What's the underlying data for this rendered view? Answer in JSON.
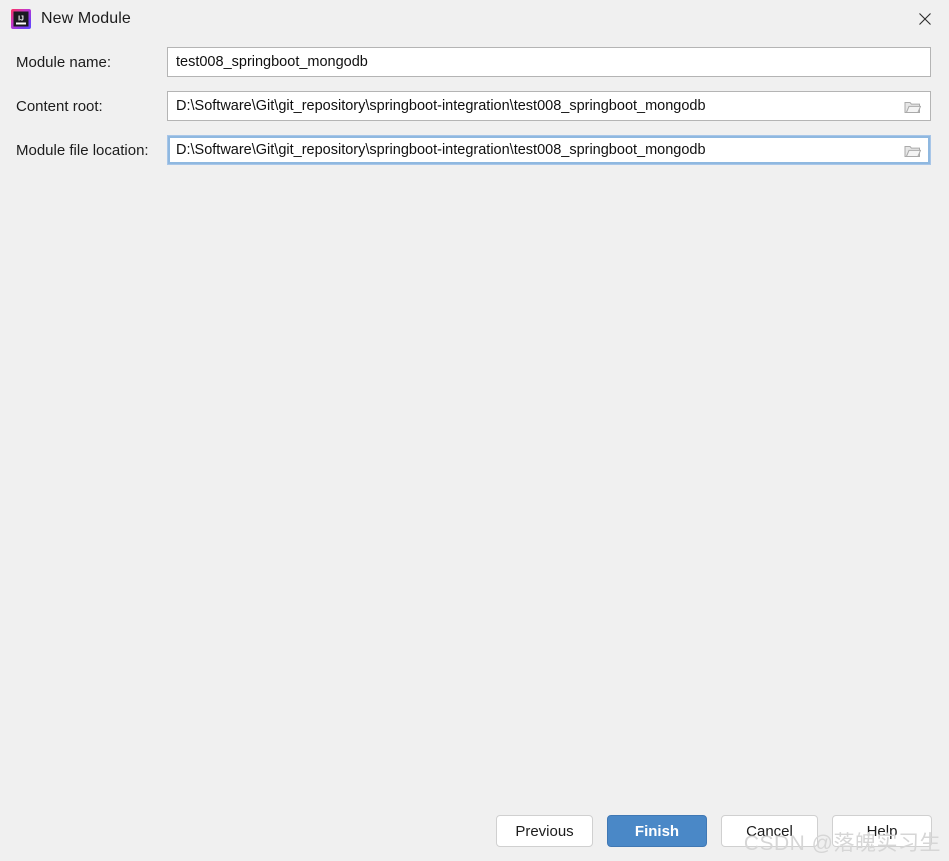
{
  "window": {
    "title": "New Module",
    "app_icon": "intellij-idea-icon",
    "close_icon": "close-icon",
    "background_color": "#f0f0f0"
  },
  "form": {
    "fields": [
      {
        "label": "Module name:",
        "value": "test008_springboot_mongodb",
        "has_browse": false,
        "focused": false
      },
      {
        "label": "Content root:",
        "value": "D:\\Software\\Git\\git_repository\\springboot-integration\\test008_springboot_mongodb",
        "has_browse": true,
        "focused": false
      },
      {
        "label": "Module file location:",
        "value": "D:\\Software\\Git\\git_repository\\springboot-integration\\test008_springboot_mongodb",
        "has_browse": true,
        "focused": true
      }
    ],
    "browse_icon": "folder-icon"
  },
  "footer": {
    "previous_label": "Previous",
    "finish_label": "Finish",
    "cancel_label": "Cancel",
    "help_label": "Help",
    "finish_color": "#4a88c7"
  },
  "watermark": {
    "text": "CSDN @落魄实习生",
    "color": "#d6d6d6"
  }
}
